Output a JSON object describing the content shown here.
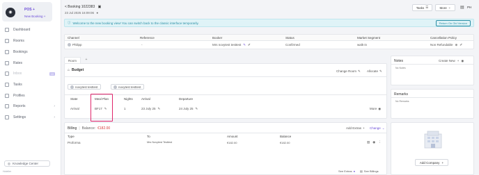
{
  "sidebar": {
    "brand_initial": "◉",
    "pos_label": "POS +",
    "new_booking_label": "New Booking +",
    "items": [
      {
        "label": "Dashboard",
        "icon": "grid-icon"
      },
      {
        "label": "Rooms",
        "icon": "bed-icon"
      },
      {
        "label": "Bookings",
        "icon": "calendar-icon"
      },
      {
        "label": "Rates",
        "icon": "tag-icon"
      },
      {
        "label": "Inbox",
        "icon": "inbox-icon",
        "badge": "10"
      },
      {
        "label": "Tasks",
        "icon": "check-icon"
      },
      {
        "label": "Profiles",
        "icon": "user-icon"
      },
      {
        "label": "Reports",
        "icon": "chart-icon",
        "chevron": "›"
      },
      {
        "label": "Settings",
        "icon": "gear-icon",
        "chevron": "›"
      }
    ],
    "knowledge_center": "Knowledge Center",
    "footer": "Hotelier"
  },
  "header": {
    "booking_title": "< Booking 1022383",
    "date": "23 Jul 2025 16:09:06",
    "tasks_label": "Tasks",
    "more_label": "More",
    "user_initials": "PH"
  },
  "banner": {
    "text": "Welcome to the new booking view! You can switch back to the classic interface temporarily.",
    "button": "Return On Old Version"
  },
  "channel_table": {
    "headers": [
      "Channel",
      "Reference",
      "Booker",
      "Status",
      "Market Segment",
      "Cancellation Policy"
    ],
    "row": {
      "channel": "Philipp",
      "reference": "-",
      "booker": "Mrs novytest testtest",
      "status": "Confirmed",
      "market_segment": "walk-in",
      "cancellation_policy": "Non Refundable"
    }
  },
  "room": {
    "tab_label": "Room",
    "tab_add": "+",
    "budget_label": "Budget",
    "change_room": "Change Room",
    "allocate": "Allocate",
    "guests": [
      "novytest testtest",
      "novytest testtest"
    ],
    "headers": [
      "State",
      "Meal Plan",
      "Nights",
      "Arrival",
      "Departure"
    ],
    "row": {
      "state": "Arrival",
      "meal_plan": "BF17",
      "nights": "1",
      "arrival": "23 July 25",
      "departure": "24 July 25",
      "more": "More"
    }
  },
  "billing": {
    "title": "Billing",
    "balance_label": "Balance:",
    "balance_value": "€182.00",
    "add_extras": "Add Extras",
    "change": "Change",
    "headers": [
      "Type",
      "To",
      "Amount",
      "Balance"
    ],
    "row": {
      "type": "Proforma",
      "to": "Mrs Novytest Testtest",
      "amount": "€182.00",
      "balance": "€182.00"
    },
    "see_extras": "See Extras",
    "see_billings": "See Billings"
  },
  "notes": {
    "title": "Notes",
    "create_new": "Create New",
    "empty": "No Notes"
  },
  "remarks": {
    "title": "Remarks",
    "empty": "No Remarks"
  },
  "company": {
    "add_label": "Add Company"
  },
  "colors": {
    "accent": "#6b4bd8",
    "highlight": "#e0256b",
    "banner": "#dff3f7",
    "balance": "#d63b3b"
  }
}
